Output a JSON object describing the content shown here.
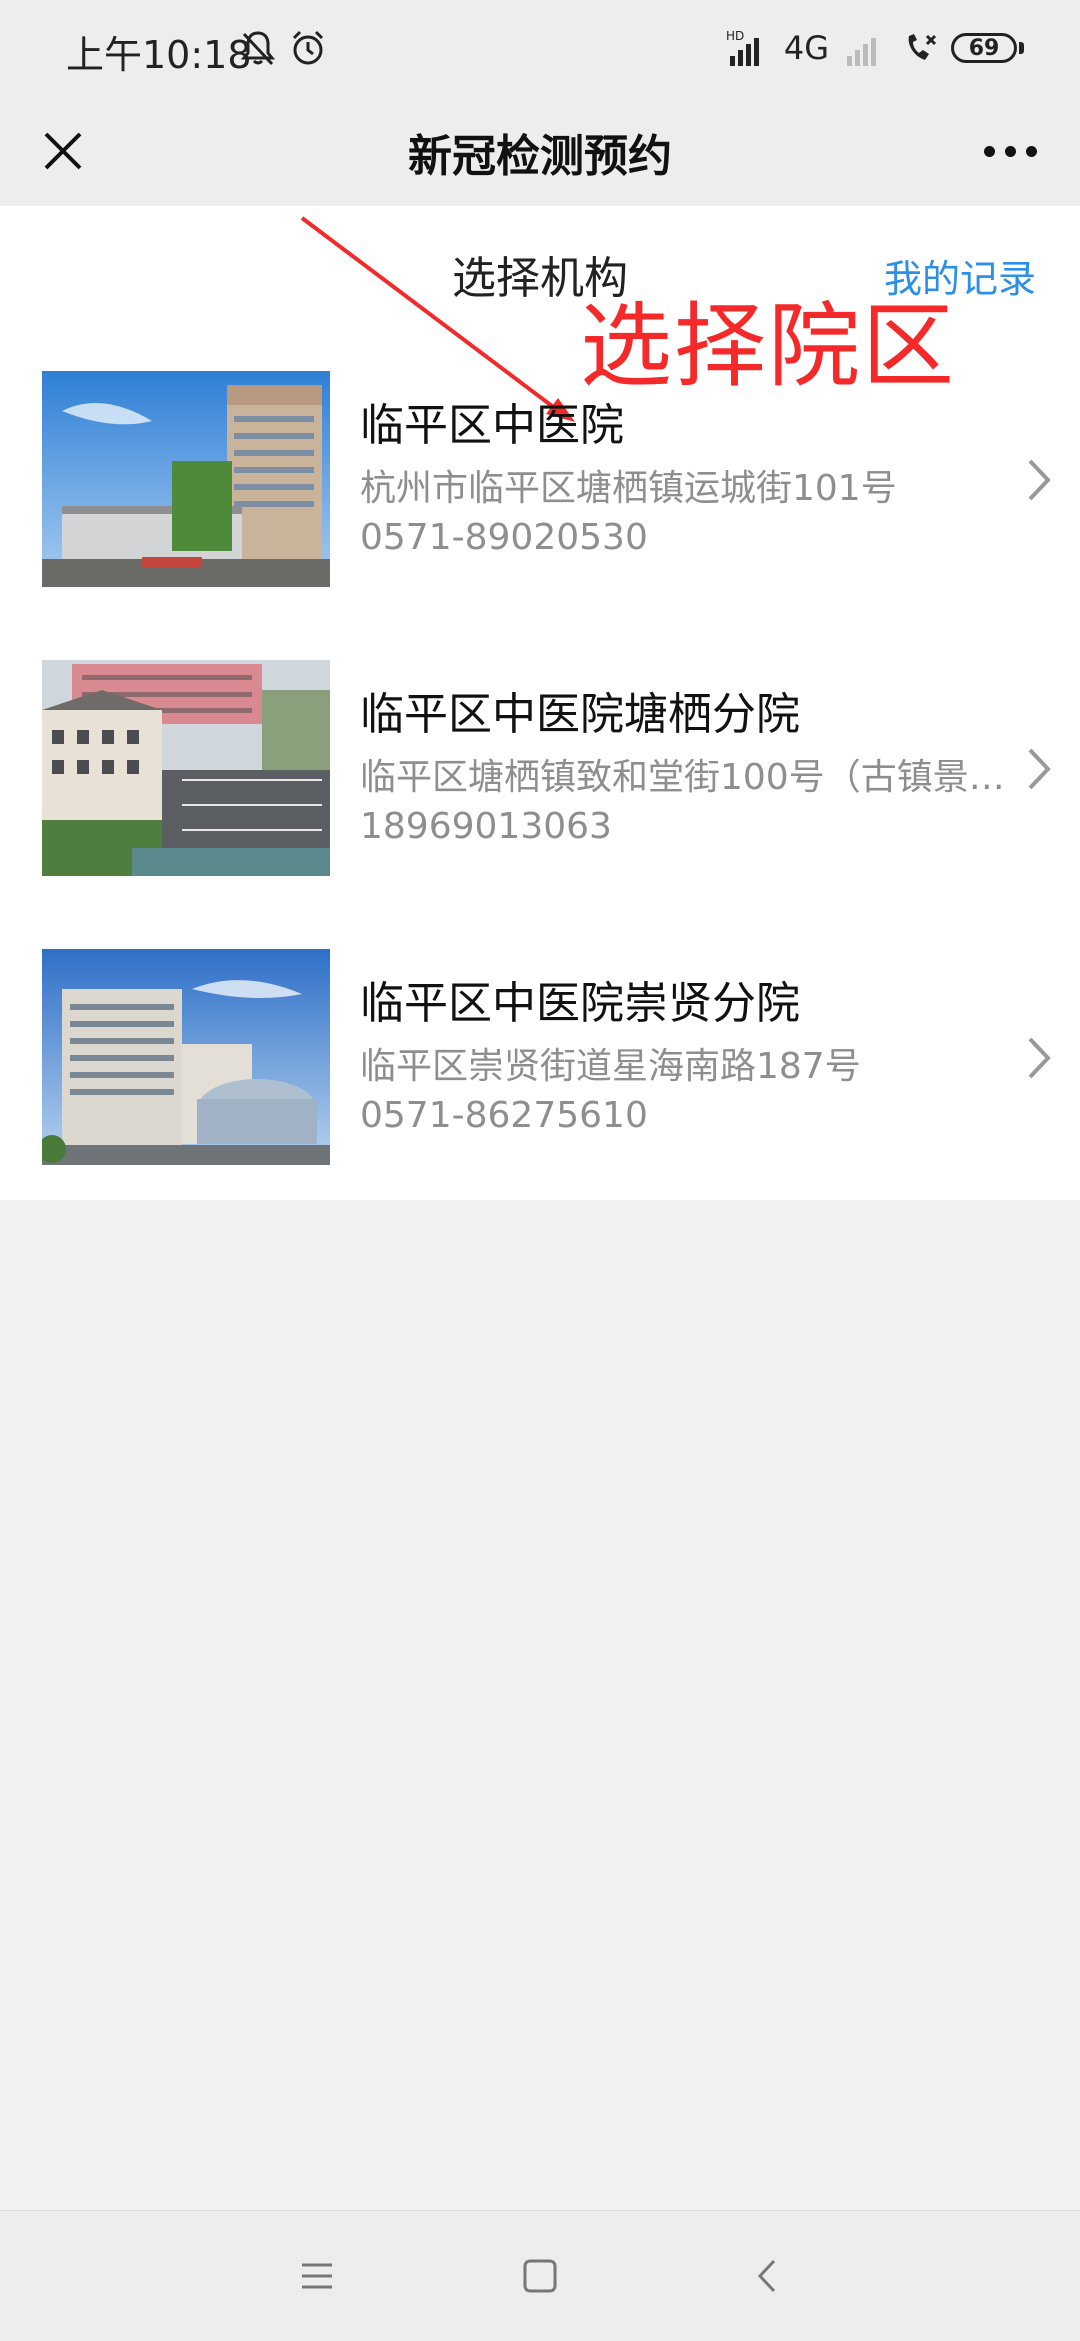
{
  "status_bar": {
    "time": "上午10:18",
    "network": "4G",
    "battery": "69",
    "icons": [
      "bell-muted-icon",
      "alarm-icon",
      "hd-signal-icon",
      "signal-icon",
      "call-icon",
      "battery-icon"
    ]
  },
  "nav": {
    "title": "新冠检测预约",
    "close_icon": "close-icon",
    "more_icon": "more-icon"
  },
  "header": {
    "section_title": "选择机构",
    "my_records": "我的记录"
  },
  "annotation": {
    "text": "选择院区",
    "color": "#f42a2a"
  },
  "hospitals": [
    {
      "name": "临平区中医院",
      "address": "杭州市临平区塘栖镇运城街101号",
      "phone": "0571-89020530"
    },
    {
      "name": "临平区中医院塘栖分院",
      "address": "临平区塘栖镇致和堂街100号（古镇景…",
      "phone": "18969013063"
    },
    {
      "name": "临平区中医院崇贤分院",
      "address": "临平区崇贤街道星海南路187号",
      "phone": "0571-86275610"
    }
  ],
  "colors": {
    "accent": "#2d8fe6",
    "annotation": "#f42a2a",
    "secondary_text": "#8e8e8e"
  },
  "system_nav": [
    "menu-icon",
    "home-icon",
    "back-icon"
  ]
}
